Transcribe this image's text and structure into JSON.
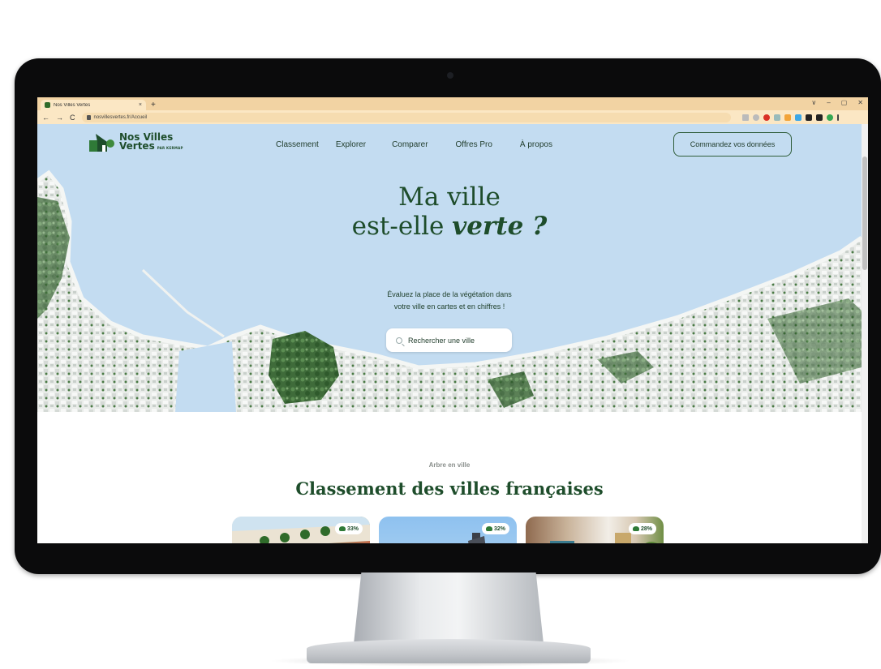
{
  "browser": {
    "tab_title": "Nos Villes Vertes",
    "tab_close": "×",
    "new_tab": "+",
    "url": "nosvillesvertes.fr/Accueil",
    "window_controls": [
      "∨",
      "–",
      "▢",
      "✕"
    ]
  },
  "header": {
    "logo_line1": "Nos Villes",
    "logo_line2": "Vertes",
    "logo_byline": "PAR KERMAP",
    "nav": [
      "Classement",
      "Explorer",
      "Comparer",
      "Offres Pro",
      "À propos"
    ],
    "cta": "Commandez vos données"
  },
  "hero": {
    "title_line1": "Ma ville",
    "title_line2_prefix": "est-elle ",
    "title_line2_emphasis": "verte ?",
    "subtitle_line1": "Évaluez la place de la végétation dans",
    "subtitle_line2": "votre ville en cartes et en chiffres !",
    "search_placeholder": "Rechercher une ville"
  },
  "ranking": {
    "eyebrow": "Arbre en ville",
    "title": "Classement des villes françaises",
    "cards": [
      {
        "badge": "33%"
      },
      {
        "badge": "32%"
      },
      {
        "badge": "28%"
      }
    ]
  },
  "colors": {
    "brand_green": "#1e4d2b",
    "sky": "#c3dcf1",
    "browser_chrome": "#f2d3a3"
  }
}
